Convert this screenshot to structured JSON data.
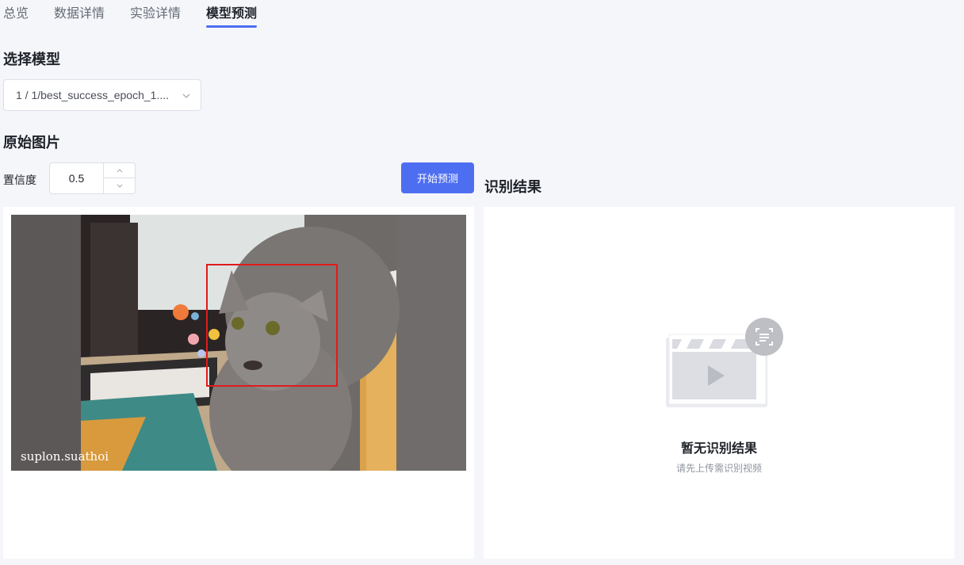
{
  "tabs": [
    {
      "label": "总览",
      "active": false
    },
    {
      "label": "数据详情",
      "active": false
    },
    {
      "label": "实验详情",
      "active": false
    },
    {
      "label": "模型预测",
      "active": true
    }
  ],
  "model_section": {
    "title": "选择模型",
    "select_value": "1 / 1/best_success_epoch_1...."
  },
  "image_section": {
    "title": "原始图片",
    "confidence_label": "置信度",
    "confidence_value": "0.5",
    "predict_button": "开始预测",
    "watermark": "suplon.suathoi"
  },
  "result_section": {
    "title": "识别结果",
    "empty_title": "暂无识别结果",
    "empty_subtitle": "请先上传需识别视频"
  },
  "colors": {
    "accent": "#4e6ef2",
    "bbox": "#e01b1b",
    "background": "#f5f6fa"
  }
}
